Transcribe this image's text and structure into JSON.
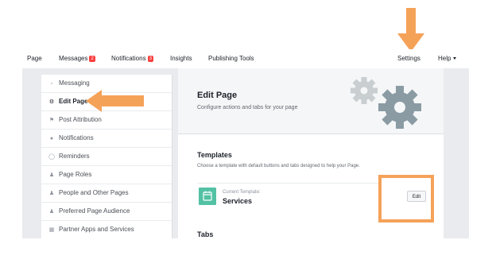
{
  "topnav": {
    "page": "Page",
    "messages": "Messages",
    "messages_badge": "2",
    "notifications": "Notifications",
    "notifications_badge": "3",
    "insights": "Insights",
    "publishing_tools": "Publishing Tools",
    "settings": "Settings",
    "help": "Help"
  },
  "sidebar": {
    "items": [
      {
        "label": "Messaging",
        "icon": "chat-icon"
      },
      {
        "label": "Edit Page",
        "icon": "gear-icon"
      },
      {
        "label": "Post Attribution",
        "icon": "flag-icon"
      },
      {
        "label": "Notifications",
        "icon": "globe-icon"
      },
      {
        "label": "Reminders",
        "icon": "clock-icon"
      },
      {
        "label": "Page Roles",
        "icon": "person-icon"
      },
      {
        "label": "People and Other Pages",
        "icon": "people-icon"
      },
      {
        "label": "Preferred Page Audience",
        "icon": "people-icon"
      },
      {
        "label": "Partner Apps and Services",
        "icon": "apps-icon"
      }
    ]
  },
  "hero": {
    "title": "Edit Page",
    "subtitle": "Configure actions and tabs for your page"
  },
  "templates": {
    "title": "Templates",
    "description": "Choose a template with default buttons and tabs designed to help your Page.",
    "current_label": "Current Template:",
    "current_name": "Services",
    "edit_label": "Edit"
  },
  "tabs": {
    "title": "Tabs"
  },
  "colors": {
    "highlight": "#f5a259",
    "template_icon": "#53c1a4",
    "badge": "#fa3e3e",
    "gear_dark": "#8a9ba4",
    "gear_light": "#c9ced1"
  }
}
